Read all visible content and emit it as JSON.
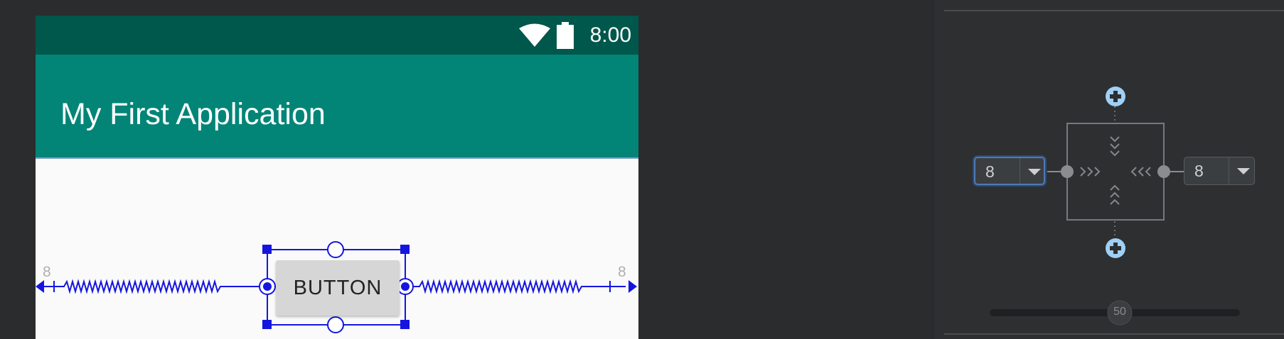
{
  "device": {
    "status_bar": {
      "time": "8:00",
      "icons": [
        "wifi-icon",
        "battery-icon"
      ]
    },
    "app_bar": {
      "title": "My First Application"
    },
    "widget": {
      "label": "BUTTON"
    },
    "margins": {
      "left": "8",
      "right": "8"
    }
  },
  "attributes_panel": {
    "margin_left": "8",
    "margin_right": "8",
    "horizontal_bias": "50",
    "add_constraint_icons": [
      "plus-icon",
      "plus-icon"
    ]
  },
  "colors": {
    "status_bar": "#00574b",
    "app_bar": "#028577",
    "selection": "#1515e0",
    "panel_bg": "#2d2f31",
    "dropdown_focus": "#4f79b6",
    "add_icon": "#9fd0f5"
  }
}
